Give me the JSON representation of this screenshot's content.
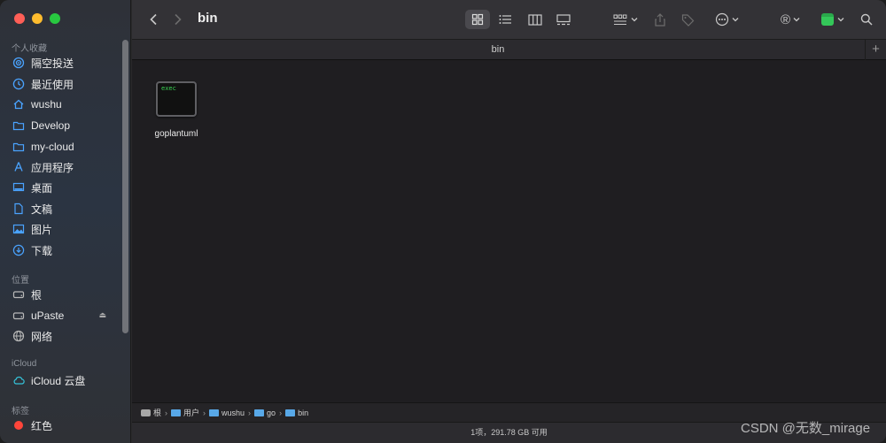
{
  "window": {
    "traffic": [
      "close",
      "minimize",
      "zoom"
    ]
  },
  "sidebar": {
    "favorites_title": "个人收藏",
    "favorites": [
      {
        "label": "隔空投送",
        "icon": "airdrop-icon"
      },
      {
        "label": "最近使用",
        "icon": "clock-icon"
      },
      {
        "label": "wushu",
        "icon": "home-icon"
      },
      {
        "label": "Develop",
        "icon": "folder-icon"
      },
      {
        "label": "my-cloud",
        "icon": "folder-icon"
      },
      {
        "label": "应用程序",
        "icon": "applications-icon"
      },
      {
        "label": "桌面",
        "icon": "desktop-icon"
      },
      {
        "label": "文稿",
        "icon": "document-icon"
      },
      {
        "label": "图片",
        "icon": "photos-icon"
      },
      {
        "label": "下载",
        "icon": "download-icon"
      }
    ],
    "locations_title": "位置",
    "locations": [
      {
        "label": "根",
        "icon": "disk-icon"
      },
      {
        "label": "uPaste",
        "icon": "disk-icon"
      },
      {
        "label": "网络",
        "icon": "network-icon"
      }
    ],
    "icloud_title": "iCloud",
    "icloud": [
      {
        "label": "iCloud 云盘",
        "icon": "cloud-icon"
      }
    ],
    "tags_title": "标签",
    "tags": [
      {
        "label": "红色",
        "color": "#ff453a"
      }
    ]
  },
  "toolbar": {
    "title": "bin",
    "back": "back",
    "forward": "forward"
  },
  "tabbar": {
    "label": "bin",
    "plus": "+"
  },
  "content": {
    "files": [
      {
        "name": "goplantuml",
        "badge": "exec",
        "icon": "terminal-executable-icon"
      }
    ]
  },
  "pathbar": {
    "crumbs": [
      "根",
      "用户",
      "wushu",
      "go",
      "bin"
    ]
  },
  "status": {
    "text": "1项，291.78 GB 可用"
  },
  "watermark": "CSDN @无数_mirage"
}
